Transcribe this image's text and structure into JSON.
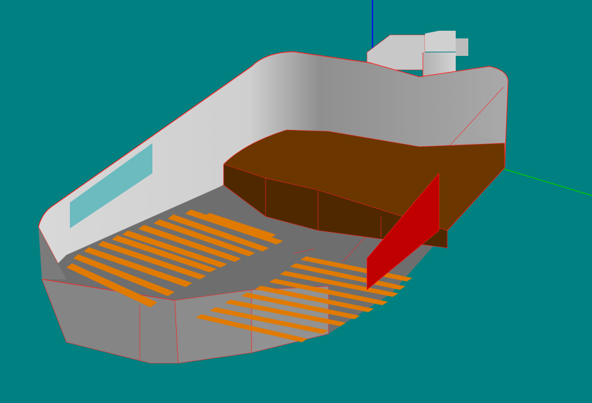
{
  "viewport": {
    "background": "#008080",
    "colors": {
      "hull_wall": "#cfcfcf",
      "hull_wall_shade": "#8e8e8e",
      "hull_edge": "#ff2020",
      "floor": "#6e6e6e",
      "bottom_facet": "#888888",
      "bench_stripe": "#e07a00",
      "deck_top": "#6b3600",
      "deck_side": "#4a2600",
      "red_panel": "#c00000",
      "window": "#5fb8bd",
      "axis_y": "#0000ff",
      "axis_x": "#00cc00"
    }
  }
}
